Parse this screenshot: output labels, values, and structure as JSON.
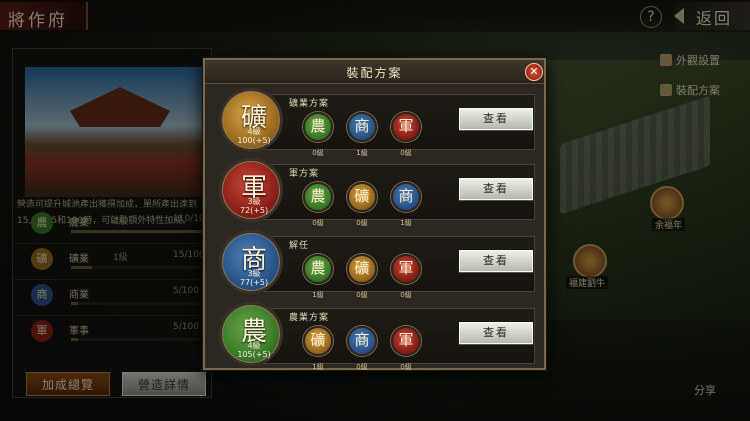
{
  "header": {
    "title": "將作府",
    "help_label": "?",
    "back_label": "返回"
  },
  "left_panel": {
    "description": "營造可提升城池產出獲得加成，單所產出達到15,50,75和100時，可啟動額外特性加成。",
    "rows": [
      {
        "name": "農業",
        "level": "4級",
        "value": "110/100",
        "icon": "農",
        "color": "#3a7a28"
      },
      {
        "name": "礦業",
        "level": "1級",
        "value": "15/100",
        "icon": "礦",
        "color": "#9a6a1e"
      },
      {
        "name": "商業",
        "level": "",
        "value": "5/100",
        "icon": "商",
        "color": "#2a5488"
      },
      {
        "name": "軍事",
        "level": "",
        "value": "5/100",
        "icon": "軍",
        "color": "#8a2018"
      }
    ],
    "bonus_button": "加成總覽",
    "detail_button": "營造詳情"
  },
  "side_links": {
    "appearance": "外觀設置",
    "equip_plan": "裝配方案",
    "share": "分享"
  },
  "map_labels": {
    "unit_a": "余福年",
    "unit_b": "福建劉牛"
  },
  "modal": {
    "title": "裝配方案",
    "close_label": "✕",
    "view_label": "查看",
    "plans": [
      {
        "name": "礦業方案",
        "main": {
          "glyph": "礦",
          "level": "4級",
          "value": "100(+5)",
          "color": "mine"
        },
        "slots": [
          {
            "glyph": "農",
            "level": "0級",
            "color": "agr"
          },
          {
            "glyph": "商",
            "level": "1級",
            "color": "com"
          },
          {
            "glyph": "軍",
            "level": "0級",
            "color": "mil"
          }
        ]
      },
      {
        "name": "軍方案",
        "main": {
          "glyph": "軍",
          "level": "3級",
          "value": "72(+5)",
          "color": "mil"
        },
        "slots": [
          {
            "glyph": "農",
            "level": "0級",
            "color": "agr"
          },
          {
            "glyph": "礦",
            "level": "0級",
            "color": "mine"
          },
          {
            "glyph": "商",
            "level": "1級",
            "color": "com"
          }
        ]
      },
      {
        "name": "解任",
        "main": {
          "glyph": "商",
          "level": "3級",
          "value": "77(+5)",
          "color": "com"
        },
        "slots": [
          {
            "glyph": "農",
            "level": "1級",
            "color": "agr"
          },
          {
            "glyph": "礦",
            "level": "0級",
            "color": "mine"
          },
          {
            "glyph": "軍",
            "level": "0級",
            "color": "mil"
          }
        ]
      },
      {
        "name": "農業方案",
        "main": {
          "glyph": "農",
          "level": "4級",
          "value": "105(+5)",
          "color": "agr"
        },
        "slots": [
          {
            "glyph": "礦",
            "level": "1級",
            "color": "mine"
          },
          {
            "glyph": "商",
            "level": "0級",
            "color": "com"
          },
          {
            "glyph": "軍",
            "level": "0級",
            "color": "mil"
          }
        ]
      }
    ]
  }
}
